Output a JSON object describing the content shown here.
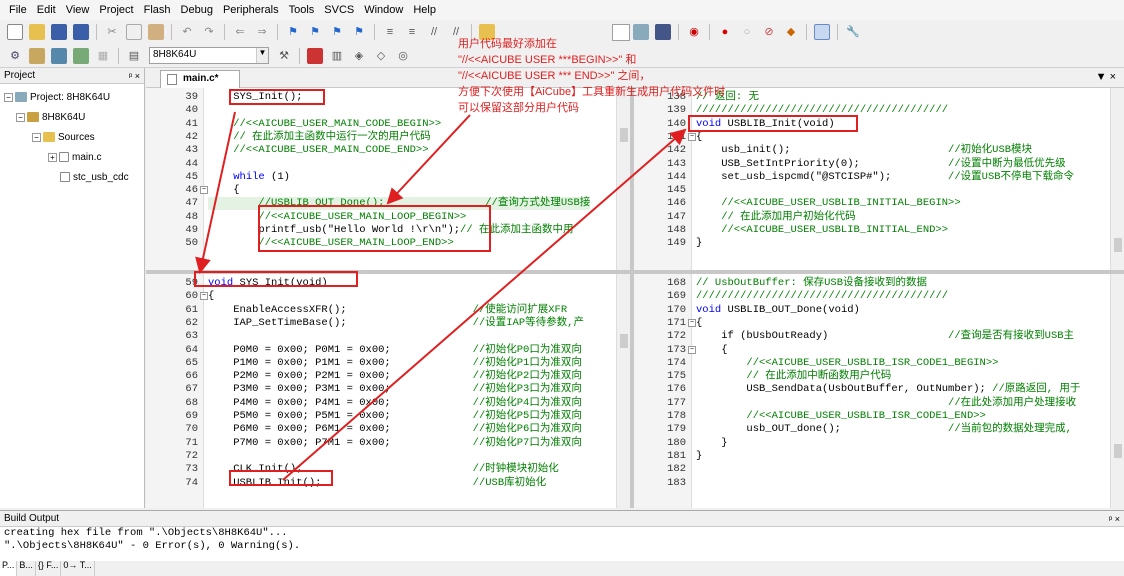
{
  "menu": [
    "File",
    "Edit",
    "View",
    "Project",
    "Flash",
    "Debug",
    "Peripherals",
    "Tools",
    "SVCS",
    "Window",
    "Help"
  ],
  "toolbar": {
    "target": "8H8K64U"
  },
  "project_panel": {
    "title": "Project",
    "pin": "p ×",
    "tree": [
      {
        "label": "Project: 8H8K64U",
        "level": 0
      },
      {
        "label": "8H8K64U",
        "level": 1
      },
      {
        "label": "Sources",
        "level": 2
      },
      {
        "label": "main.c",
        "level": 3
      },
      {
        "label": "stc_usb_cdc",
        "level": 3
      }
    ],
    "tabs": [
      "P...",
      "B...",
      "{} F...",
      "0→ T..."
    ]
  },
  "editor": {
    "tab": "main.c*",
    "pane_tl": {
      "lines": [
        {
          "n": "39",
          "fold": "",
          "t": "    SYS_Init();",
          "c": "pl"
        },
        {
          "n": "40",
          "fold": "",
          "t": "",
          "c": "pl"
        },
        {
          "n": "41",
          "fold": "",
          "t": "    //<<AICUBE_USER_MAIN_CODE_BEGIN>>",
          "c": "cm"
        },
        {
          "n": "42",
          "fold": "",
          "t": "    // 在此添加主函数中运行一次的用户代码",
          "c": "cm"
        },
        {
          "n": "43",
          "fold": "",
          "t": "    //<<AICUBE_USER_MAIN_CODE_END>>",
          "c": "cm"
        },
        {
          "n": "44",
          "fold": "",
          "t": "",
          "c": "pl"
        },
        {
          "n": "45",
          "fold": "",
          "t": "    while (1)",
          "c": "kw"
        },
        {
          "n": "46",
          "fold": "-",
          "t": "    {",
          "c": "pl"
        },
        {
          "n": "47",
          "fold": "",
          "t": "        //USBLIB_OUT_Done();                //查询方式处理USB接",
          "c": "cm",
          "hl": true
        },
        {
          "n": "48",
          "fold": "",
          "t": "        //<<AICUBE_USER_MAIN_LOOP_BEGIN>>",
          "c": "cm"
        },
        {
          "n": "49",
          "fold": "",
          "t": "        printf_usb(\"Hello World !\\r\\n\");// 在此添加主函数中用",
          "c": "mix1"
        },
        {
          "n": "50",
          "fold": "",
          "t": "        //<<AICUBE_USER_MAIN_LOOP_END>>",
          "c": "cm"
        }
      ]
    },
    "pane_bl": {
      "lines": [
        {
          "n": "59",
          "fold": "",
          "t": "void SYS_Init(void)",
          "c": "kw"
        },
        {
          "n": "60",
          "fold": "-",
          "t": "{",
          "c": "pl"
        },
        {
          "n": "61",
          "fold": "",
          "t": "    EnableAccessXFR();                    //使能访问扩展XFR",
          "c": "mix"
        },
        {
          "n": "62",
          "fold": "",
          "t": "    IAP_SetTimeBase();                    //设置IAP等待参数,产",
          "c": "mix"
        },
        {
          "n": "63",
          "fold": "",
          "t": "",
          "c": "pl"
        },
        {
          "n": "64",
          "fold": "",
          "t": "    P0M0 = 0x00; P0M1 = 0x00;             //初始化P0口为准双向",
          "c": "mix"
        },
        {
          "n": "65",
          "fold": "",
          "t": "    P1M0 = 0x00; P1M1 = 0x00;             //初始化P1口为准双向",
          "c": "mix"
        },
        {
          "n": "66",
          "fold": "",
          "t": "    P2M0 = 0x00; P2M1 = 0x00;             //初始化P2口为准双向",
          "c": "mix"
        },
        {
          "n": "67",
          "fold": "",
          "t": "    P3M0 = 0x00; P3M1 = 0x00;             //初始化P3口为准双向",
          "c": "mix"
        },
        {
          "n": "68",
          "fold": "",
          "t": "    P4M0 = 0x00; P4M1 = 0x00;             //初始化P4口为准双向",
          "c": "mix"
        },
        {
          "n": "69",
          "fold": "",
          "t": "    P5M0 = 0x00; P5M1 = 0x00;             //初始化P5口为准双向",
          "c": "mix"
        },
        {
          "n": "70",
          "fold": "",
          "t": "    P6M0 = 0x00; P6M1 = 0x00;             //初始化P6口为准双向",
          "c": "mix"
        },
        {
          "n": "71",
          "fold": "",
          "t": "    P7M0 = 0x00; P7M1 = 0x00;             //初始化P7口为准双向",
          "c": "mix"
        },
        {
          "n": "72",
          "fold": "",
          "t": "",
          "c": "pl"
        },
        {
          "n": "73",
          "fold": "",
          "t": "    CLK_Init();                           //时钟模块初始化",
          "c": "mix"
        },
        {
          "n": "74",
          "fold": "",
          "t": "    USBLIB_Init();                        //USB库初始化",
          "c": "mix"
        }
      ]
    },
    "pane_tr": {
      "lines": [
        {
          "n": "138",
          "fold": "",
          "t": "// 返回: 无",
          "c": "cm"
        },
        {
          "n": "139",
          "fold": "",
          "t": "////////////////////////////////////////",
          "c": "cm"
        },
        {
          "n": "140",
          "fold": "",
          "t": "void USBLIB_Init(void)",
          "c": "kw"
        },
        {
          "n": "141",
          "fold": "-",
          "t": "{",
          "c": "pl"
        },
        {
          "n": "142",
          "fold": "",
          "t": "    usb_init();                         //初始化USB模块",
          "c": "mix"
        },
        {
          "n": "143",
          "fold": "",
          "t": "    USB_SetIntPriority(0);              //设置中断为最低优先级",
          "c": "mix"
        },
        {
          "n": "144",
          "fold": "",
          "t": "    set_usb_ispcmd(\"@STCISP#\");         //设置USB不停电下载命令",
          "c": "mix"
        },
        {
          "n": "145",
          "fold": "",
          "t": "",
          "c": "pl"
        },
        {
          "n": "146",
          "fold": "",
          "t": "    //<<AICUBE_USER_USBLIB_INITIAL_BEGIN>>",
          "c": "cm"
        },
        {
          "n": "147",
          "fold": "",
          "t": "    // 在此添加用户初始化代码",
          "c": "cm"
        },
        {
          "n": "148",
          "fold": "",
          "t": "    //<<AICUBE_USER_USBLIB_INITIAL_END>>",
          "c": "cm"
        },
        {
          "n": "149",
          "fold": "",
          "t": "}",
          "c": "pl"
        }
      ]
    },
    "pane_br": {
      "lines": [
        {
          "n": "168",
          "fold": "",
          "t": "// UsbOutBuffer: 保存USB设备接收到的数据",
          "c": "cm"
        },
        {
          "n": "169",
          "fold": "",
          "t": "////////////////////////////////////////",
          "c": "cm"
        },
        {
          "n": "170",
          "fold": "",
          "t": "void USBLIB_OUT_Done(void)",
          "c": "kw"
        },
        {
          "n": "171",
          "fold": "-",
          "t": "{",
          "c": "pl"
        },
        {
          "n": "172",
          "fold": "",
          "t": "    if (bUsbOutReady)                   //查询是否有接收到USB主",
          "c": "mix"
        },
        {
          "n": "173",
          "fold": "-",
          "t": "    {",
          "c": "pl"
        },
        {
          "n": "174",
          "fold": "",
          "t": "        //<<AICUBE_USER_USBLIB_ISR_CODE1_BEGIN>>",
          "c": "cm"
        },
        {
          "n": "175",
          "fold": "",
          "t": "        // 在此添加中断函数用户代码",
          "c": "cm"
        },
        {
          "n": "176",
          "fold": "",
          "t": "        USB_SendData(UsbOutBuffer, OutNumber); //原路返回, 用于",
          "c": "mix"
        },
        {
          "n": "177",
          "fold": "",
          "t": "                                        //在此处添加用户处理接收",
          "c": "cm"
        },
        {
          "n": "178",
          "fold": "",
          "t": "        //<<AICUBE_USER_USBLIB_ISR_CODE1_END>>",
          "c": "cm"
        },
        {
          "n": "179",
          "fold": "",
          "t": "        usb_OUT_done();                 //当前包的数据处理完成,",
          "c": "mix"
        },
        {
          "n": "180",
          "fold": "",
          "t": "    }",
          "c": "pl"
        },
        {
          "n": "181",
          "fold": "",
          "t": "}",
          "c": "pl"
        },
        {
          "n": "182",
          "fold": "",
          "t": "",
          "c": "pl"
        },
        {
          "n": "183",
          "fold": "",
          "t": "",
          "c": "pl"
        }
      ]
    }
  },
  "annotation": [
    "用户代码最好添加在",
    "\"//<<AICUBE USER ***BEGIN>>\"  和",
    "\"//<<AICUBE USER *** END>>\"  之间，",
    "方便下次使用【AiCube】工具重新生成用户代码文件时",
    "可以保留这部分用户代码"
  ],
  "build_output": {
    "title": "Build Output",
    "lines": [
      "creating hex file from \".\\Objects\\8H8K64U\"...",
      "\".\\Objects\\8H8K64U\" - 0 Error(s), 0 Warning(s)."
    ]
  }
}
